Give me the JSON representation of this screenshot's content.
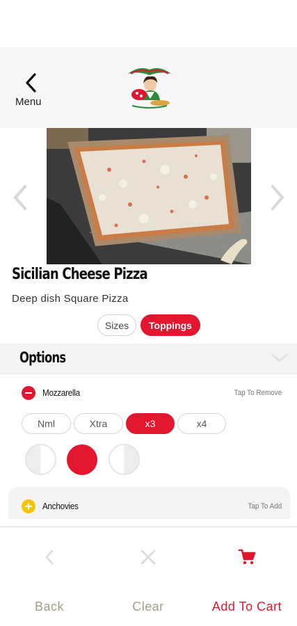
{
  "header": {
    "back_label": "Menu",
    "logo_icon": "restaurant-logo"
  },
  "product": {
    "title": "Sicilian Cheese Pizza",
    "description": "Deep dish Square Pizza"
  },
  "segments": {
    "sizes": "Sizes",
    "toppings": "Toppings",
    "selected": "Toppings"
  },
  "options": {
    "title": "Options"
  },
  "toppings": [
    {
      "name": "Mozzarella",
      "hint": "Tap To Remove",
      "selected": true,
      "amounts": [
        "Nml",
        "Xtra",
        "x3",
        "x4"
      ],
      "selected_amount": "x3",
      "portion": "whole"
    },
    {
      "name": "Anchovies",
      "hint": "Tap To Add",
      "selected": false
    }
  ],
  "footer": {
    "back": "Back",
    "clear": "Clear",
    "add_to_cart": "Add To Cart"
  },
  "colors": {
    "accent": "#e2162e",
    "add_icon": "#f6c400",
    "muted_label": "#a39f85"
  }
}
